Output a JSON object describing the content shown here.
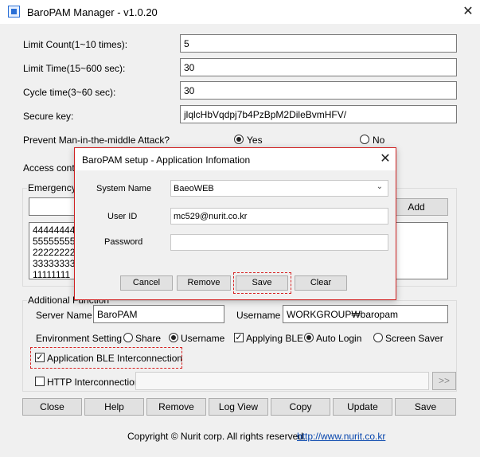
{
  "window": {
    "title": "BaroPAM Manager - v1.0.20",
    "close_glyph": "✕"
  },
  "settings": {
    "limit_count": {
      "label": "Limit Count(1~10 times):",
      "value": "5"
    },
    "limit_time": {
      "label": "Limit Time(15~600 sec):",
      "value": "30"
    },
    "cycle_time": {
      "label": "Cycle time(3~60 sec):",
      "value": "30"
    },
    "secure_key": {
      "label": "Secure key:",
      "value": "jlqlcHbVqdpj7b4PzBpM2DileBvmHFV/"
    },
    "mitm": {
      "label": "Prevent Man-in-the-middle Attack?",
      "yes": "Yes",
      "no": "No",
      "selected": "Yes"
    },
    "access_control_label": "Access contr"
  },
  "emergency": {
    "legend": "Emergency",
    "add_label": "Add",
    "items": [
      "44444444",
      "55555555",
      "22222222",
      "33333333",
      "11111111"
    ]
  },
  "additional": {
    "legend": "Additional Function",
    "server_name_label": "Server Name",
    "server_name_value": "BaroPAM",
    "username_label": "Username",
    "username_value": "WORKGROUP₩baropam",
    "env_label": "Environment Setting",
    "env_options": [
      "Share",
      "Username"
    ],
    "env_selected": "Username",
    "applying_ble_label": "Applying BLE",
    "applying_ble_checked": true,
    "login_options": [
      "Auto Login",
      "Screen Saver"
    ],
    "login_selected": "Auto Login",
    "app_ble_label": "Application BLE Interconnection",
    "app_ble_checked": true,
    "http_label": "HTTP Interconnection",
    "http_checked": false,
    "http_button": ">>"
  },
  "buttons": [
    "Close",
    "Help",
    "Remove",
    "Log View",
    "Copy",
    "Update",
    "Save"
  ],
  "footer": {
    "copyright": "Copyright © Nurit corp. All rights reserved.",
    "link": "http://www.nurit.co.kr"
  },
  "dialog": {
    "title": "BaroPAM setup - Application Infomation",
    "close_glyph": "✕",
    "system_name_label": "System Name",
    "system_name_value": "BaeoWEB",
    "user_id_label": "User ID",
    "user_id_value": "mc529@nurit.co.kr",
    "password_label": "Password",
    "password_value": "",
    "buttons": [
      "Cancel",
      "Remove",
      "Save",
      "Clear"
    ]
  },
  "colors": {
    "highlight_red": "#d62020",
    "link_blue": "#0645ad"
  }
}
